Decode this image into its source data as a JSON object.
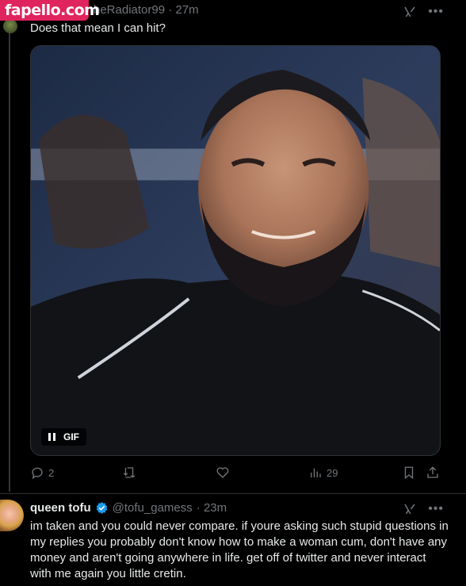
{
  "watermark": "fapello.com",
  "tweet1": {
    "header": "heRadiator99 · 27m",
    "text": "Does that mean I can hit?",
    "media_badge": "GIF",
    "actions": {
      "replies": "2",
      "retweets": "",
      "likes": "",
      "views": "29"
    }
  },
  "tweet2": {
    "name": "queen tofu",
    "handle": "@tofu_gamess",
    "time": "· 23m",
    "text": "im taken and you could never compare. if youre asking such stupid questions in my replies you probably don't know how to make a woman cum, don't have any money and aren't going anywhere in life. get off of twitter and never interact with me again you little cretin."
  },
  "icons": [
    "grok-icon",
    "more-icon",
    "pause-icon",
    "reply-icon",
    "retweet-icon",
    "like-icon",
    "views-icon",
    "bookmark-icon",
    "share-icon",
    "verified-icon"
  ],
  "colors": {
    "background": "#000000",
    "text": "#e7e9ea",
    "muted": "#71767b",
    "verified": "#1d9bf0",
    "watermark": "#e0245e"
  }
}
